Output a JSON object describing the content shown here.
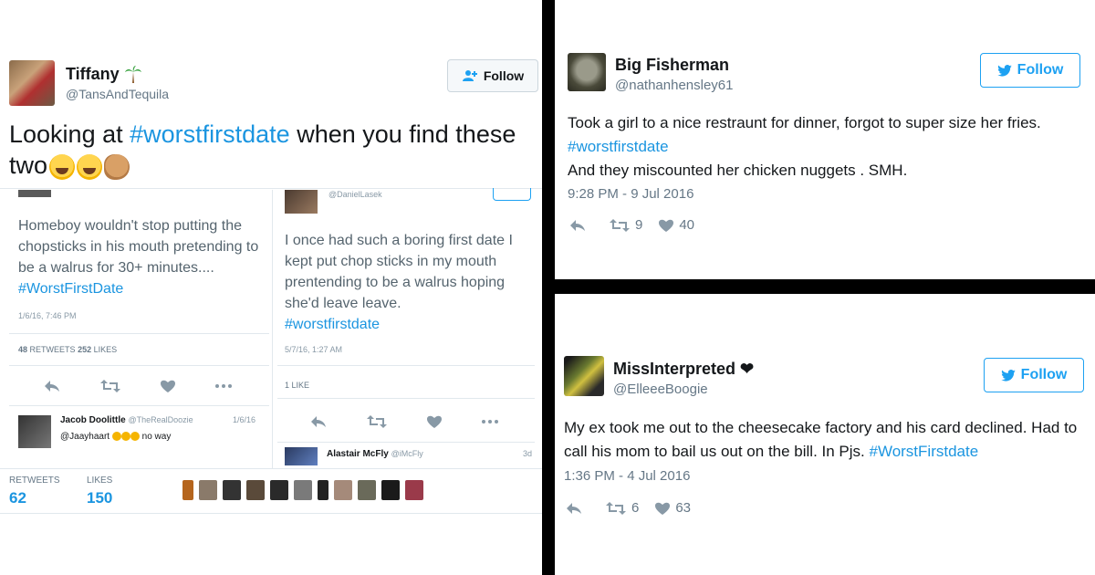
{
  "left": {
    "user_name": "Tiffany",
    "user_handle": "@TansAndTequila",
    "follow_label": "Follow",
    "text_prefix": "Looking at ",
    "hashtag": "#worstfirstdate",
    "text_suffix": " when you find these",
    "text_line2": "two",
    "retweets_label": "RETWEETS",
    "retweets": "62",
    "likes_label": "LIKES",
    "likes": "150",
    "embedded_a": {
      "text": "Homeboy wouldn't stop putting the chopsticks in his mouth pretending to be a walrus for 30+ minutes.... ",
      "hashtag": "#WorstFirstDate",
      "time": "1/6/16, 7:46 PM",
      "retweets": "48",
      "retweets_label": "RETWEETS",
      "likes": "252",
      "likes_label": "LIKES",
      "reply_name": "Jacob Doolittle",
      "reply_handle": "@TheRealDoozie",
      "reply_date": "1/6/16",
      "reply_to": "@Jaayhaart",
      "reply_text": "no way"
    },
    "embedded_b": {
      "handle": "@DanielLasek",
      "text": "I once had such a boring first date I kept put chop sticks in my mouth prentending to be a walrus hoping she'd leave leave.",
      "hashtag": "#worstfirstdate",
      "time": "5/7/16, 1:27 AM",
      "likes_line": "1 LIKE",
      "reply_name": "Alastair McFly",
      "reply_handle": "@iMcFly",
      "reply_date": "3d"
    }
  },
  "top_right": {
    "user_name": "Big Fisherman",
    "user_handle": "@nathanhensley61",
    "follow_label": "Follow",
    "text_line1": "Took a girl to a nice restraunt for dinner, forgot to super size her fries. ",
    "hashtag": "#worstfirstdate",
    "text_line2": "And they miscounted her chicken nuggets . SMH.",
    "timestamp": "9:28 PM - 9 Jul 2016",
    "retweets": "9",
    "likes": "40"
  },
  "bottom_right": {
    "user_name": "MissInterpreted ❤",
    "user_handle": "@ElleeeBoogie",
    "follow_label": "Follow",
    "text": "My ex took me out to the cheesecake factory and his card declined. Had to call his mom to bail us out on the bill. In Pjs. ",
    "hashtag": "#WorstFirstdate",
    "timestamp": "1:36 PM - 4 Jul 2016",
    "retweets": "6",
    "likes": "63"
  },
  "colors": {
    "link": "#1b95e0",
    "follow": "#1da1f2",
    "muted": "#657786",
    "separator": "#000000"
  },
  "icons": [
    "reply-icon",
    "retweet-icon",
    "heart-icon",
    "more-icon",
    "twitter-bird-icon",
    "add-user-icon",
    "palm-tree-icon"
  ]
}
